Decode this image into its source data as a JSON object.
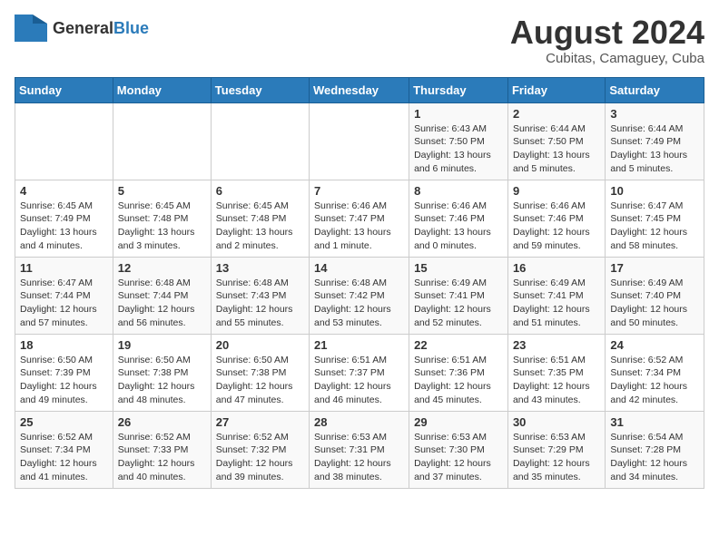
{
  "header": {
    "logo_general": "General",
    "logo_blue": "Blue",
    "month_year": "August 2024",
    "location": "Cubitas, Camaguey, Cuba"
  },
  "days_of_week": [
    "Sunday",
    "Monday",
    "Tuesday",
    "Wednesday",
    "Thursday",
    "Friday",
    "Saturday"
  ],
  "weeks": [
    [
      {
        "day": "",
        "info": ""
      },
      {
        "day": "",
        "info": ""
      },
      {
        "day": "",
        "info": ""
      },
      {
        "day": "",
        "info": ""
      },
      {
        "day": "1",
        "info": "Sunrise: 6:43 AM\nSunset: 7:50 PM\nDaylight: 13 hours and 6 minutes."
      },
      {
        "day": "2",
        "info": "Sunrise: 6:44 AM\nSunset: 7:50 PM\nDaylight: 13 hours and 5 minutes."
      },
      {
        "day": "3",
        "info": "Sunrise: 6:44 AM\nSunset: 7:49 PM\nDaylight: 13 hours and 5 minutes."
      }
    ],
    [
      {
        "day": "4",
        "info": "Sunrise: 6:45 AM\nSunset: 7:49 PM\nDaylight: 13 hours and 4 minutes."
      },
      {
        "day": "5",
        "info": "Sunrise: 6:45 AM\nSunset: 7:48 PM\nDaylight: 13 hours and 3 minutes."
      },
      {
        "day": "6",
        "info": "Sunrise: 6:45 AM\nSunset: 7:48 PM\nDaylight: 13 hours and 2 minutes."
      },
      {
        "day": "7",
        "info": "Sunrise: 6:46 AM\nSunset: 7:47 PM\nDaylight: 13 hours and 1 minute."
      },
      {
        "day": "8",
        "info": "Sunrise: 6:46 AM\nSunset: 7:46 PM\nDaylight: 13 hours and 0 minutes."
      },
      {
        "day": "9",
        "info": "Sunrise: 6:46 AM\nSunset: 7:46 PM\nDaylight: 12 hours and 59 minutes."
      },
      {
        "day": "10",
        "info": "Sunrise: 6:47 AM\nSunset: 7:45 PM\nDaylight: 12 hours and 58 minutes."
      }
    ],
    [
      {
        "day": "11",
        "info": "Sunrise: 6:47 AM\nSunset: 7:44 PM\nDaylight: 12 hours and 57 minutes."
      },
      {
        "day": "12",
        "info": "Sunrise: 6:48 AM\nSunset: 7:44 PM\nDaylight: 12 hours and 56 minutes."
      },
      {
        "day": "13",
        "info": "Sunrise: 6:48 AM\nSunset: 7:43 PM\nDaylight: 12 hours and 55 minutes."
      },
      {
        "day": "14",
        "info": "Sunrise: 6:48 AM\nSunset: 7:42 PM\nDaylight: 12 hours and 53 minutes."
      },
      {
        "day": "15",
        "info": "Sunrise: 6:49 AM\nSunset: 7:41 PM\nDaylight: 12 hours and 52 minutes."
      },
      {
        "day": "16",
        "info": "Sunrise: 6:49 AM\nSunset: 7:41 PM\nDaylight: 12 hours and 51 minutes."
      },
      {
        "day": "17",
        "info": "Sunrise: 6:49 AM\nSunset: 7:40 PM\nDaylight: 12 hours and 50 minutes."
      }
    ],
    [
      {
        "day": "18",
        "info": "Sunrise: 6:50 AM\nSunset: 7:39 PM\nDaylight: 12 hours and 49 minutes."
      },
      {
        "day": "19",
        "info": "Sunrise: 6:50 AM\nSunset: 7:38 PM\nDaylight: 12 hours and 48 minutes."
      },
      {
        "day": "20",
        "info": "Sunrise: 6:50 AM\nSunset: 7:38 PM\nDaylight: 12 hours and 47 minutes."
      },
      {
        "day": "21",
        "info": "Sunrise: 6:51 AM\nSunset: 7:37 PM\nDaylight: 12 hours and 46 minutes."
      },
      {
        "day": "22",
        "info": "Sunrise: 6:51 AM\nSunset: 7:36 PM\nDaylight: 12 hours and 45 minutes."
      },
      {
        "day": "23",
        "info": "Sunrise: 6:51 AM\nSunset: 7:35 PM\nDaylight: 12 hours and 43 minutes."
      },
      {
        "day": "24",
        "info": "Sunrise: 6:52 AM\nSunset: 7:34 PM\nDaylight: 12 hours and 42 minutes."
      }
    ],
    [
      {
        "day": "25",
        "info": "Sunrise: 6:52 AM\nSunset: 7:34 PM\nDaylight: 12 hours and 41 minutes."
      },
      {
        "day": "26",
        "info": "Sunrise: 6:52 AM\nSunset: 7:33 PM\nDaylight: 12 hours and 40 minutes."
      },
      {
        "day": "27",
        "info": "Sunrise: 6:52 AM\nSunset: 7:32 PM\nDaylight: 12 hours and 39 minutes."
      },
      {
        "day": "28",
        "info": "Sunrise: 6:53 AM\nSunset: 7:31 PM\nDaylight: 12 hours and 38 minutes."
      },
      {
        "day": "29",
        "info": "Sunrise: 6:53 AM\nSunset: 7:30 PM\nDaylight: 12 hours and 37 minutes."
      },
      {
        "day": "30",
        "info": "Sunrise: 6:53 AM\nSunset: 7:29 PM\nDaylight: 12 hours and 35 minutes."
      },
      {
        "day": "31",
        "info": "Sunrise: 6:54 AM\nSunset: 7:28 PM\nDaylight: 12 hours and 34 minutes."
      }
    ]
  ]
}
